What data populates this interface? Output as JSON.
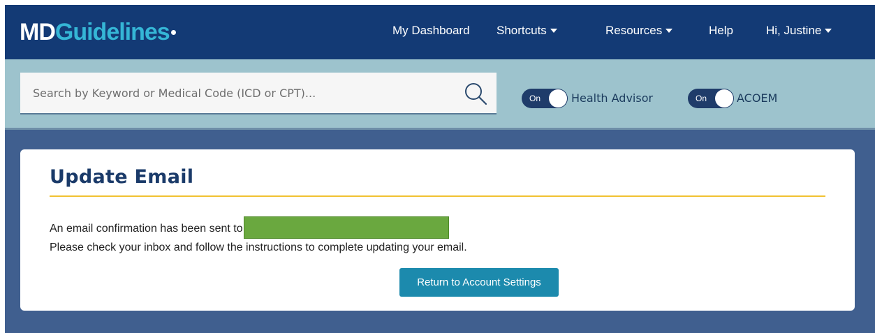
{
  "brand": {
    "part1": "MD",
    "part2": "Guidelines"
  },
  "nav": {
    "dashboard": "My Dashboard",
    "shortcuts": "Shortcuts",
    "resources": "Resources",
    "help": "Help",
    "user": "Hi, Justine"
  },
  "search": {
    "placeholder": "Search by Keyword or Medical Code (ICD or CPT)..."
  },
  "toggles": [
    {
      "state": "On",
      "label": "Health Advisor"
    },
    {
      "state": "On",
      "label": "ACOEM"
    }
  ],
  "card": {
    "title": "Update Email",
    "message1": "An email confirmation has been sent to",
    "message2": "Please check your inbox and follow the instructions to complete updating your email.",
    "button": "Return to Account Settings"
  },
  "colors": {
    "nav_bg": "#133a75",
    "accent_cyan": "#35b6d6",
    "band_bg": "#9dc3cd",
    "page_bg": "#405f8f",
    "title": "#1a3a69",
    "rule": "#f1c232",
    "button": "#1c8aad",
    "redaction": "#6aa83f"
  }
}
